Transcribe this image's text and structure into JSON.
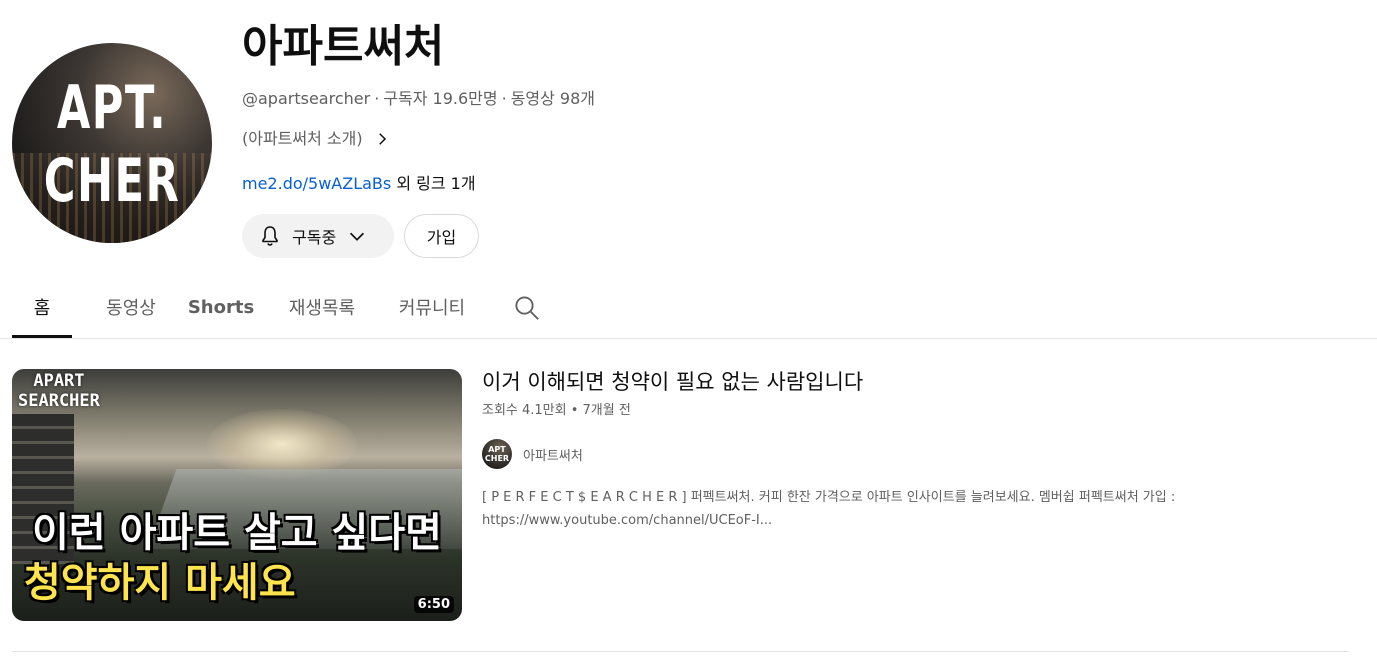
{
  "channel": {
    "avatar_text_line1": "APT.",
    "avatar_text_line2": "CHER",
    "title": "아파트써처",
    "handle": "@apartsearcher",
    "subscribers": "구독자 19.6만명",
    "video_count": "동영상 98개",
    "separator": "·",
    "description": "(아파트써처 소개)",
    "link_text": "me2.do/5wAZLaBs",
    "link_more": " 외 링크 1개",
    "subscribed_label": "구독중",
    "join_label": "가입"
  },
  "tabs": [
    {
      "label": "홈",
      "active": true
    },
    {
      "label": "동영상",
      "active": false
    },
    {
      "label": "Shorts",
      "active": false
    },
    {
      "label": "재생목록",
      "active": false
    },
    {
      "label": "커뮤니티",
      "active": false
    }
  ],
  "featured": {
    "thumb_brand_line1": "APART",
    "thumb_brand_line2": "SEARCHER",
    "thumb_caption_1": "이런 아파트 살고 싶다면",
    "thumb_caption_2": "청약하지 마세요",
    "duration": "6:50",
    "title": "이거 이해되면 청약이 필요 없는 사람입니다",
    "meta": "조회수 4.1만회 • 7개월 전",
    "channel_avatar_text": "APT CHER",
    "channel_name": "아파트써처",
    "description": "[ P E R F E C T $ E A R C H E R ] 퍼펙트써처. 커피 한잔 가격으로 아파트 인사이트를 늘려보세요. 멤버쉽 퍼펙트써처 가입 : https://www.youtube.com/channel/UCEoF-I..."
  },
  "icons": {
    "bell": "bell-icon",
    "chevron_down": "chevron-down-icon",
    "chevron_right": "chevron-right-icon",
    "search": "search-icon"
  },
  "colors": {
    "link": "#065fd4",
    "text_primary": "#0f0f0f",
    "text_secondary": "#606060",
    "caption_yellow": "#ffe44d"
  }
}
